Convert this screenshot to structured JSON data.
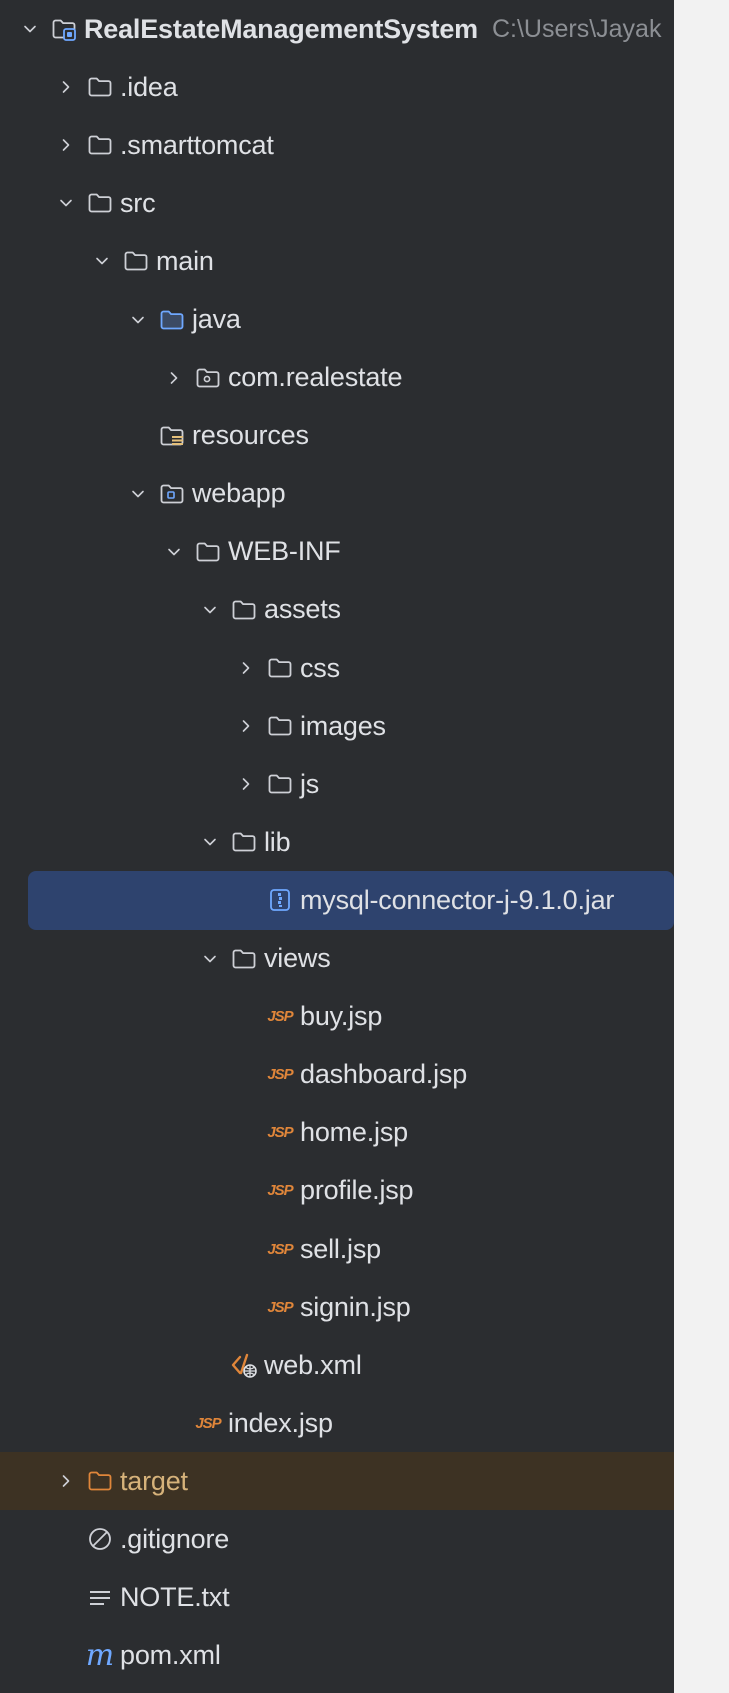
{
  "project_tree": {
    "rows": [
      {
        "label": "RealEstateManagementSystem",
        "path": "C:\\Users\\Jayak",
        "icon": "project-module-icon",
        "level": 0,
        "expanded": true
      },
      {
        "label": ".idea",
        "icon": "folder-icon",
        "level": 1,
        "expanded": false
      },
      {
        "label": ".smarttomcat",
        "icon": "folder-icon",
        "level": 1,
        "expanded": false
      },
      {
        "label": "src",
        "icon": "folder-icon",
        "level": 1,
        "expanded": true
      },
      {
        "label": "main",
        "icon": "folder-icon",
        "level": 2,
        "expanded": true
      },
      {
        "label": "java",
        "icon": "source-root-folder-icon",
        "level": 3,
        "expanded": true
      },
      {
        "label": "com.realestate",
        "icon": "package-icon",
        "level": 4,
        "expanded": false
      },
      {
        "label": "resources",
        "icon": "resources-root-icon",
        "level": 3
      },
      {
        "label": "webapp",
        "icon": "web-folder-icon",
        "level": 3,
        "expanded": true
      },
      {
        "label": "WEB-INF",
        "icon": "folder-icon",
        "level": 4,
        "expanded": true
      },
      {
        "label": "assets",
        "icon": "folder-icon",
        "level": 5,
        "expanded": true
      },
      {
        "label": "css",
        "icon": "folder-icon",
        "level": 6,
        "expanded": false
      },
      {
        "label": "images",
        "icon": "folder-icon",
        "level": 6,
        "expanded": false
      },
      {
        "label": "js",
        "icon": "folder-icon",
        "level": 6,
        "expanded": false
      },
      {
        "label": "lib",
        "icon": "folder-icon",
        "level": 5,
        "expanded": true
      },
      {
        "label": "mysql-connector-j-9.1.0.jar",
        "icon": "jar-archive-icon",
        "level": 6,
        "selected": true
      },
      {
        "label": "views",
        "icon": "folder-icon",
        "level": 5,
        "expanded": true
      },
      {
        "label": "buy.jsp",
        "icon": "jsp-file-icon",
        "level": 6
      },
      {
        "label": "dashboard.jsp",
        "icon": "jsp-file-icon",
        "level": 6
      },
      {
        "label": "home.jsp",
        "icon": "jsp-file-icon",
        "level": 6
      },
      {
        "label": "profile.jsp",
        "icon": "jsp-file-icon",
        "level": 6
      },
      {
        "label": "sell.jsp",
        "icon": "jsp-file-icon",
        "level": 6
      },
      {
        "label": "signin.jsp",
        "icon": "jsp-file-icon",
        "level": 6
      },
      {
        "label": "web.xml",
        "icon": "web-xml-icon",
        "level": 5
      },
      {
        "label": "index.jsp",
        "icon": "jsp-file-icon",
        "level": 4
      },
      {
        "label": "target",
        "icon": "excluded-folder-icon",
        "level": 1,
        "expanded": false,
        "excluded": true
      },
      {
        "label": ".gitignore",
        "icon": "ignored-file-icon",
        "level": 1
      },
      {
        "label": "NOTE.txt",
        "icon": "text-file-icon",
        "level": 1
      },
      {
        "label": "pom.xml",
        "icon": "maven-pom-icon",
        "level": 1
      }
    ],
    "jsp_icon_text": "JSP",
    "maven_icon_text": "m"
  },
  "colors": {
    "background": "#2b2d30",
    "selection": "#2e436e",
    "excluded_row": "#3d3223",
    "excluded_text": "#d6b27a",
    "text": "#dfe1e5",
    "secondary_text": "#8c8f94",
    "jsp_orange": "#e0863a",
    "accent_blue": "#6fa8ff"
  }
}
